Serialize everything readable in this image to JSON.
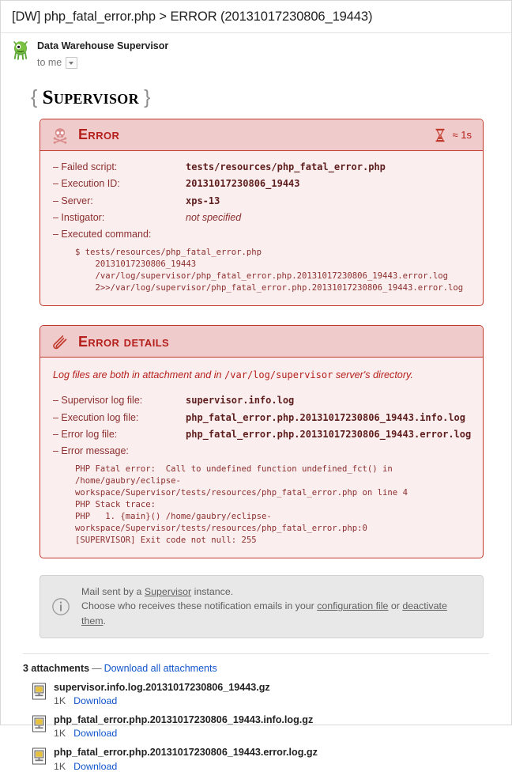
{
  "mail": {
    "subject": "[DW] php_fatal_error.php > ERROR (20131017230806_19443)",
    "sender_name": "Data Warehouse Supervisor",
    "to_line": "to me",
    "avatar_icon": "monster-avatar-icon",
    "caret_icon": "chevron-down-icon"
  },
  "logo": {
    "open_brace": "{",
    "word": "Supervisor",
    "close_brace": "}"
  },
  "error_panel": {
    "icon": "skull-and-crossbones-icon",
    "title": "Error",
    "timing_icon": "hourglass-icon",
    "timing": "≈ 1s",
    "rows": [
      {
        "label": "– Failed script:",
        "value": "tests/resources/php_fatal_error.php",
        "style": "mono"
      },
      {
        "label": "– Execution ID:",
        "value": "20131017230806_19443",
        "style": "mono"
      },
      {
        "label": "– Server:",
        "value": "xps-13",
        "style": "mono"
      },
      {
        "label": "– Instigator:",
        "value": "not specified",
        "style": "ital"
      },
      {
        "label": "– Executed command:",
        "value": "",
        "style": "none"
      }
    ],
    "command": "$ tests/resources/php_fatal_error.php\n    20131017230806_19443\n    /var/log/supervisor/php_fatal_error.php.20131017230806_19443.error.log\n    2>>/var/log/supervisor/php_fatal_error.php.20131017230806_19443.error.log"
  },
  "details_panel": {
    "icon": "paperclip-icon",
    "title": "Error details",
    "note_prefix": "Log files are both in attachment and in ",
    "note_path": "/var/log/supervisor",
    "note_suffix": " server's directory.",
    "rows": [
      {
        "label": "– Supervisor log file:",
        "value": "supervisor.info.log",
        "style": "mono"
      },
      {
        "label": "– Execution log file:",
        "value": "php_fatal_error.php.20131017230806_19443.info.log",
        "style": "mono"
      },
      {
        "label": "– Error log file:",
        "value": "php_fatal_error.php.20131017230806_19443.error.log",
        "style": "mono"
      },
      {
        "label": "– Error message:",
        "value": "",
        "style": "none"
      }
    ],
    "error_message": "PHP Fatal error:  Call to undefined function undefined_fct() in /home/gaubry/eclipse-workspace/Supervisor/tests/resources/php_fatal_error.php on line 4\nPHP Stack trace:\nPHP   1. {main}() /home/gaubry/eclipse-workspace/Supervisor/tests/resources/php_fatal_error.php:0\n[SUPERVISOR] Exit code not null: 255"
  },
  "info_box": {
    "icon": "info-circle-icon",
    "line1_prefix": "Mail sent by a ",
    "line1_link": "Supervisor",
    "line1_suffix": " instance.",
    "line2_prefix": "Choose who receives these notification emails in your ",
    "line2_link1": "configuration file",
    "line2_middle": " or ",
    "line2_link2": "deactivate them",
    "line2_suffix": "."
  },
  "attachments": {
    "count_label": "3 attachments",
    "dash": "—",
    "download_all": "Download all attachments",
    "items": [
      {
        "icon": "file-attachment-icon",
        "name": "supervisor.info.log.20131017230806_19443.gz",
        "size": "1K",
        "action": "Download"
      },
      {
        "icon": "file-attachment-icon",
        "name": "php_fatal_error.php.20131017230806_19443.info.log.gz",
        "size": "1K",
        "action": "Download"
      },
      {
        "icon": "file-attachment-icon",
        "name": "php_fatal_error.php.20131017230806_19443.error.log.gz",
        "size": "1K",
        "action": "Download"
      }
    ]
  },
  "colors": {
    "error_red": "#b5201d",
    "panel_border": "#c0392b",
    "panel_head_bg": "#f0cbcb",
    "panel_body_bg": "#fbeeee",
    "link_blue": "#1155cc",
    "info_bg": "#e8e8e8"
  }
}
